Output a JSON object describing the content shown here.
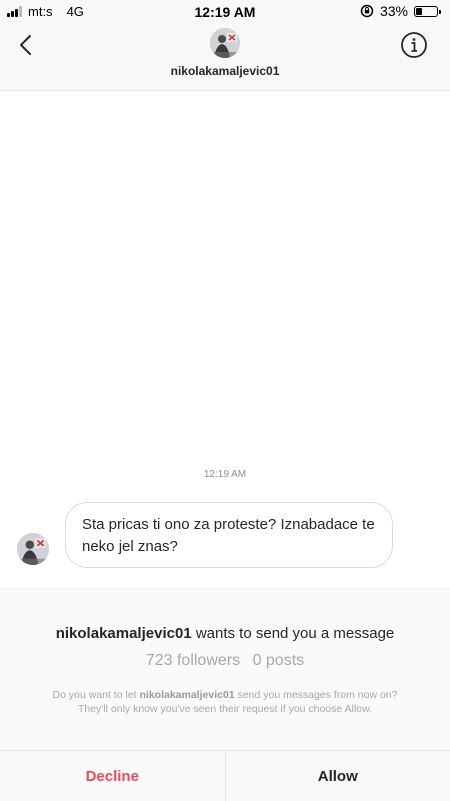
{
  "status_bar": {
    "carrier": "mt:s",
    "network": "4G",
    "time": "12:19 AM",
    "battery_percent": "33%",
    "battery_level": 0.33
  },
  "header": {
    "username": "nikolakamaljevic01",
    "back_icon": "chevron-left-icon",
    "info_icon": "info-icon"
  },
  "thread": {
    "timestamp": "12:19 AM",
    "messages": [
      {
        "text": "Sta pricas ti ono za proteste? Iznabadace te neko jel znas?"
      }
    ]
  },
  "request": {
    "username": "nikolakamaljevic01",
    "title_suffix": "wants to send you a message",
    "followers": "723 followers",
    "posts": "0 posts",
    "note_prefix": "Do you want to let",
    "note_username": "nikolakamaljevic01",
    "note_suffix": "send you messages from now on? They'll only know you've seen their request if you choose Allow."
  },
  "actions": {
    "decline_label": "Decline",
    "allow_label": "Allow",
    "decline_color": "#ed4956"
  }
}
